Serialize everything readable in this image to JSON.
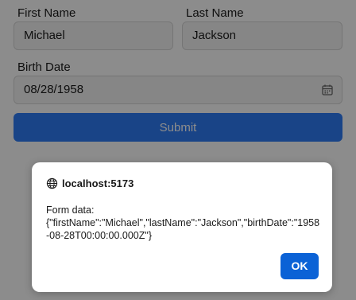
{
  "form": {
    "first_name_label": "First Name",
    "first_name_value": "Michael",
    "last_name_label": "Last Name",
    "last_name_value": "Jackson",
    "birth_date_label": "Birth Date",
    "birth_date_value": "08/28/1958",
    "birth_date_icon": "calendar-icon",
    "submit_label": "Submit",
    "submit_color": "#2f7cf6"
  },
  "dialog": {
    "origin_icon": "globe-icon",
    "origin": "localhost:5173",
    "message_line1": "Form data:",
    "message_line2": "{\"firstName\":\"Michael\",\"lastName\":\"Jackson\",\"birthDate\":\"1958-08-28T00:00:00.000Z\"}",
    "ok_label": "OK",
    "ok_color": "#0b62d6"
  }
}
